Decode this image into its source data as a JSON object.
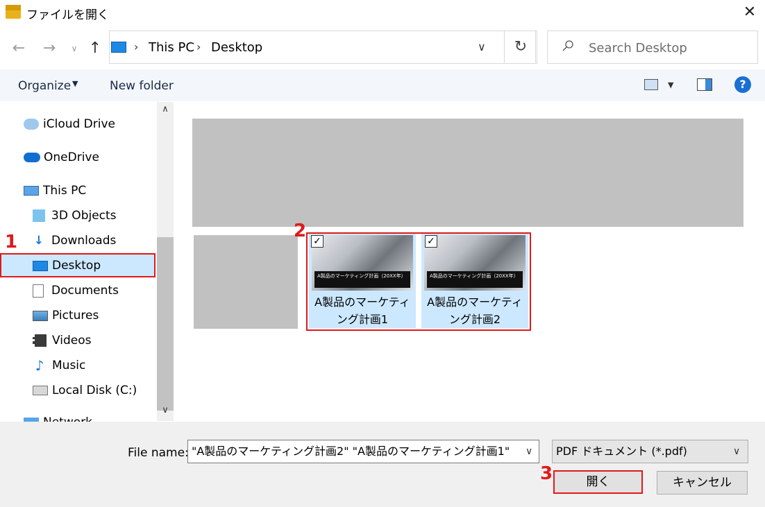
{
  "window": {
    "title": "ファイルを開く"
  },
  "address": {
    "root": "This PC",
    "current": "Desktop"
  },
  "search": {
    "placeholder": "Search Desktop"
  },
  "toolbar": {
    "organize": "Organize",
    "new_folder": "New folder"
  },
  "nav": {
    "items": [
      {
        "label": "iCloud Drive",
        "icon": "cloud-icon"
      },
      {
        "label": "OneDrive",
        "icon": "onedrive-icon"
      },
      {
        "label": "This PC",
        "icon": "computer-icon"
      },
      {
        "label": "3D Objects",
        "icon": "cube-icon"
      },
      {
        "label": "Downloads",
        "icon": "download-arrow-icon"
      },
      {
        "label": "Desktop",
        "icon": "desktop-icon"
      },
      {
        "label": "Documents",
        "icon": "document-icon"
      },
      {
        "label": "Pictures",
        "icon": "picture-icon"
      },
      {
        "label": "Videos",
        "icon": "film-icon"
      },
      {
        "label": "Music",
        "icon": "music-note-icon"
      },
      {
        "label": "Local Disk (C:)",
        "icon": "disk-icon"
      },
      {
        "label": "Network",
        "icon": "network-icon"
      }
    ]
  },
  "files": [
    {
      "name": "A製品のマーケティング計画1",
      "line1": "A製品のマーケティ",
      "line2": "ング計画1",
      "thumb_caption": "A製品のマーケティング計画（20XX年）"
    },
    {
      "name": "A製品のマーケティング計画2",
      "line1": "A製品のマーケティ",
      "line2": "ング計画2",
      "thumb_caption": "A製品のマーケティング計画（20XX年）"
    }
  ],
  "bottom": {
    "file_name_label": "File name:",
    "file_name_value": "\"A製品のマーケティング計画2\" \"A製品のマーケティング計画1\"",
    "file_type": "PDF ドキュメント (*.pdf)",
    "open_label": "開く",
    "cancel_label": "キャンセル"
  },
  "annotations": {
    "step1": "1",
    "step2": "2",
    "step3": "3"
  },
  "colors": {
    "highlight": "#e11919",
    "selection": "#cce8ff",
    "accent": "#1b6fd1"
  }
}
